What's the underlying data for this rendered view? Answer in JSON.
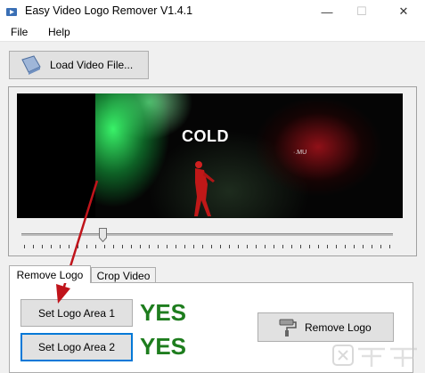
{
  "window": {
    "title": "Easy Video Logo Remover V1.4.1",
    "minimize_glyph": "—",
    "maximize_glyph": "☐",
    "close_glyph": "✕"
  },
  "menu": {
    "items": [
      "File",
      "Help"
    ]
  },
  "toolbar": {
    "load_video_label": "Load Video File...",
    "icon": "film-icon"
  },
  "preview": {
    "overlay_text": "COLD",
    "overlay_small_text": "·.MU"
  },
  "slider": {
    "position": 0.22
  },
  "tabs": [
    {
      "label": "Remove Logo",
      "active": true
    },
    {
      "label": "Crop Video",
      "active": false
    }
  ],
  "remove_logo_panel": {
    "set_area_1_label": "Set Logo Area 1",
    "set_area_2_label": "Set Logo Area 2",
    "yes_1": "YES",
    "yes_2": "YES",
    "remove_logo_label": "Remove Logo",
    "remove_icon": "paint-roller-icon"
  },
  "colors": {
    "yes_green": "#1e7d1e",
    "arrow_red": "#c0141b",
    "focus_blue": "#0078d7"
  }
}
